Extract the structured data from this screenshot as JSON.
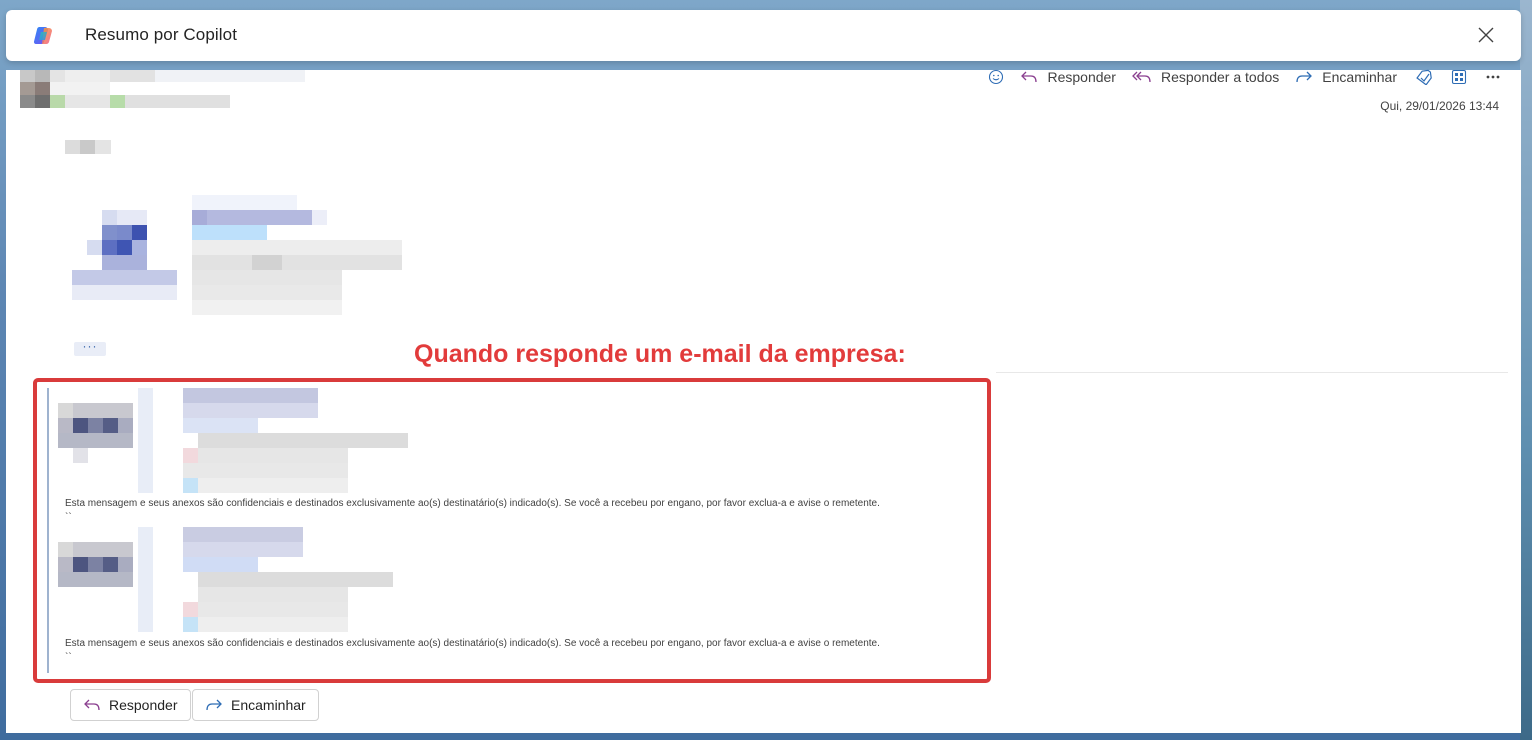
{
  "banner": {
    "title": "Resumo por Copilot",
    "logo_icon": "copilot-icon",
    "close_icon": "close-icon"
  },
  "toolbar": {
    "emoji_icon": "emoji-icon",
    "reply_label": "Responder",
    "reply_all_label": "Responder a todos",
    "forward_label": "Encaminhar",
    "extra_icons": [
      "tag-icon",
      "apps-icon",
      "more-icon"
    ]
  },
  "message": {
    "date": "Qui, 29/01/2026 13:44",
    "more_label": "···"
  },
  "annotation": {
    "text": "Quando responde um e-mail da empresa:",
    "color": "#e23b3b"
  },
  "quoted": {
    "disclaimer_1": "Esta mensagem e seus anexos são confidenciais e destinados exclusivamente ao(s) destinatário(s) indicado(s). Se você a recebeu por engano, por favor exclua-a e avise o remetente.",
    "backticks_1": "``",
    "disclaimer_2": "Esta mensagem e seus anexos são confidenciais e destinados exclusivamente ao(s) destinatário(s) indicado(s). Se você a recebeu por engano, por favor exclua-a e avise o remetente.",
    "backticks_2": "``"
  },
  "footer": {
    "reply_label": "Responder",
    "forward_label": "Encaminhar"
  },
  "colors": {
    "accent_reply": "#8a3f8f",
    "accent_forward": "#2f6db5",
    "highlight_border": "#d93b3b"
  }
}
